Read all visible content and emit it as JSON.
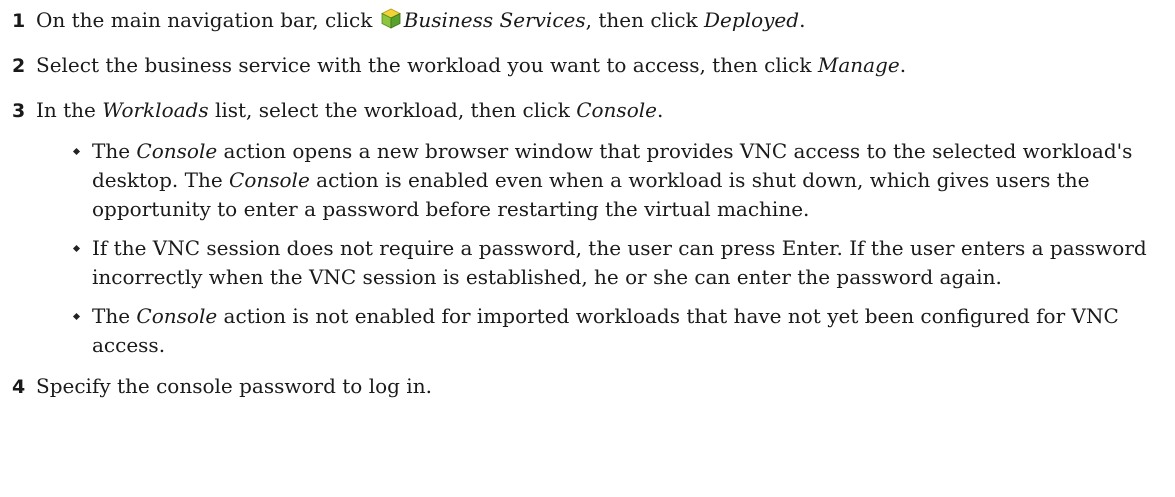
{
  "steps": [
    {
      "number": "1",
      "t1": "On the main navigation bar, click ",
      "icon": "business-services-icon",
      "e1": "Business Services",
      "t2": ", then click ",
      "e2": "Deployed",
      "t3": "."
    },
    {
      "number": "2",
      "t1": "Select the business service with the workload you want to access, then click ",
      "e1": "Manage",
      "t2": "."
    },
    {
      "number": "3",
      "t1": "In the ",
      "e1": "Workloads",
      "t2": " list, select the workload, then click ",
      "e2": "Console",
      "t3": "."
    },
    {
      "number": "4",
      "t1": "Specify the console password to log in."
    }
  ],
  "bullets": [
    {
      "t1": "The ",
      "e1": "Console",
      "t2": " action opens a new browser window that provides VNC access to the selected workload's desktop. The ",
      "e2": "Console",
      "t3": " action is enabled even when a workload is shut down, which gives users the opportunity to enter a password before restarting the virtual machine."
    },
    {
      "t1": "If the VNC session does not require a password, the user can press Enter. If the user enters a password incorrectly when the VNC session is established, he or she can enter the password again."
    },
    {
      "t1": "The ",
      "e1": "Console",
      "t2": " action is not enabled for imported workloads that have not yet been configured for VNC access."
    }
  ],
  "colors": {
    "icon_top": "#f2d23a",
    "icon_left": "#8cc63f",
    "icon_right": "#5aa02c"
  }
}
